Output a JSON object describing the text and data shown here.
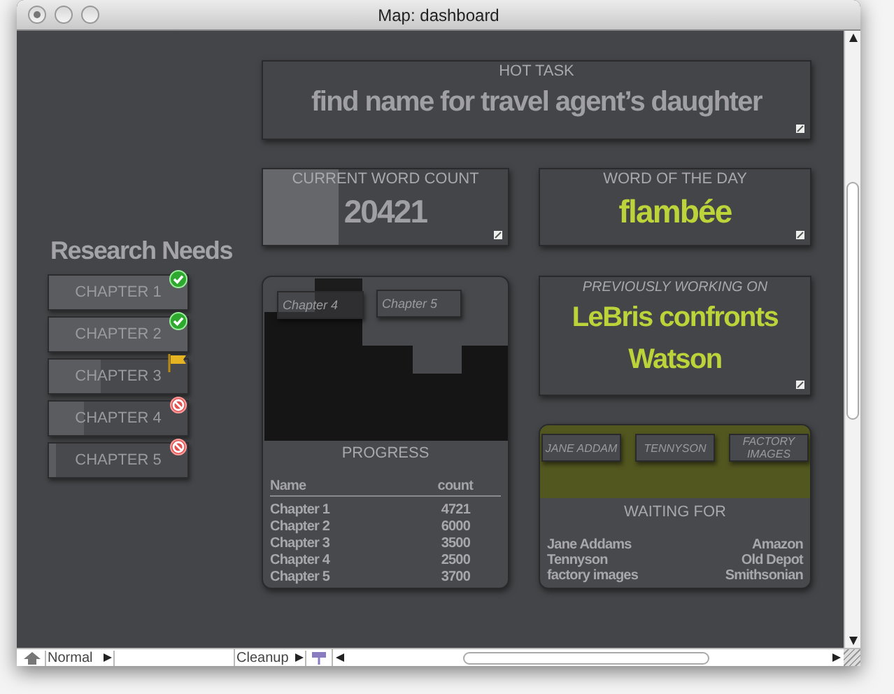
{
  "window": {
    "title": "Map: dashboard"
  },
  "hot_task": {
    "label": "HOT TASK",
    "value": "find name for travel agent’s daughter"
  },
  "word_count": {
    "label": "CURRENT WORD COUNT",
    "value": "20421",
    "level": 0.31
  },
  "word_of_day": {
    "label": "WORD OF THE DAY",
    "value": "flambée"
  },
  "research_needs": {
    "title": "Research Needs",
    "items": [
      {
        "label": "CHAPTER 1",
        "level": 1.0,
        "kind": "done"
      },
      {
        "label": "CHAPTER 2",
        "level": 1.0,
        "kind": "done"
      },
      {
        "label": "CHAPTER 3",
        "level": 0.37,
        "kind": "flagged"
      },
      {
        "label": "CHAPTER 4",
        "level": 0.25,
        "kind": "blocked"
      },
      {
        "label": "CHAPTER 5",
        "level": 0.05,
        "kind": "blocked"
      }
    ]
  },
  "progress": {
    "chart_labels": [
      "Chapter 4",
      "Chapter 5"
    ],
    "title": "PROGRESS",
    "columns": [
      "Name",
      "count"
    ],
    "rows": [
      [
        "Chapter 1",
        "4721"
      ],
      [
        "Chapter 2",
        "6000"
      ],
      [
        "Chapter 3",
        "3500"
      ],
      [
        "Chapter 4",
        "2500"
      ],
      [
        "Chapter 5",
        "3700"
      ]
    ]
  },
  "previously_working_on": {
    "label": "PREVIOUSLY WORKING ON",
    "value": "LeBris confronts Watson"
  },
  "waiting_for": {
    "tags": [
      "JANE ADDAM",
      "TENNYSON",
      "FACTORY IMAGES"
    ],
    "title": "WAITING FOR",
    "rows": [
      [
        "Jane Addams",
        "Amazon"
      ],
      [
        "Tennyson",
        "Old Depot"
      ],
      [
        "factory images",
        "Smithsonian"
      ]
    ]
  },
  "bottom_bar": {
    "mode": "Normal",
    "action": "Cleanup"
  }
}
